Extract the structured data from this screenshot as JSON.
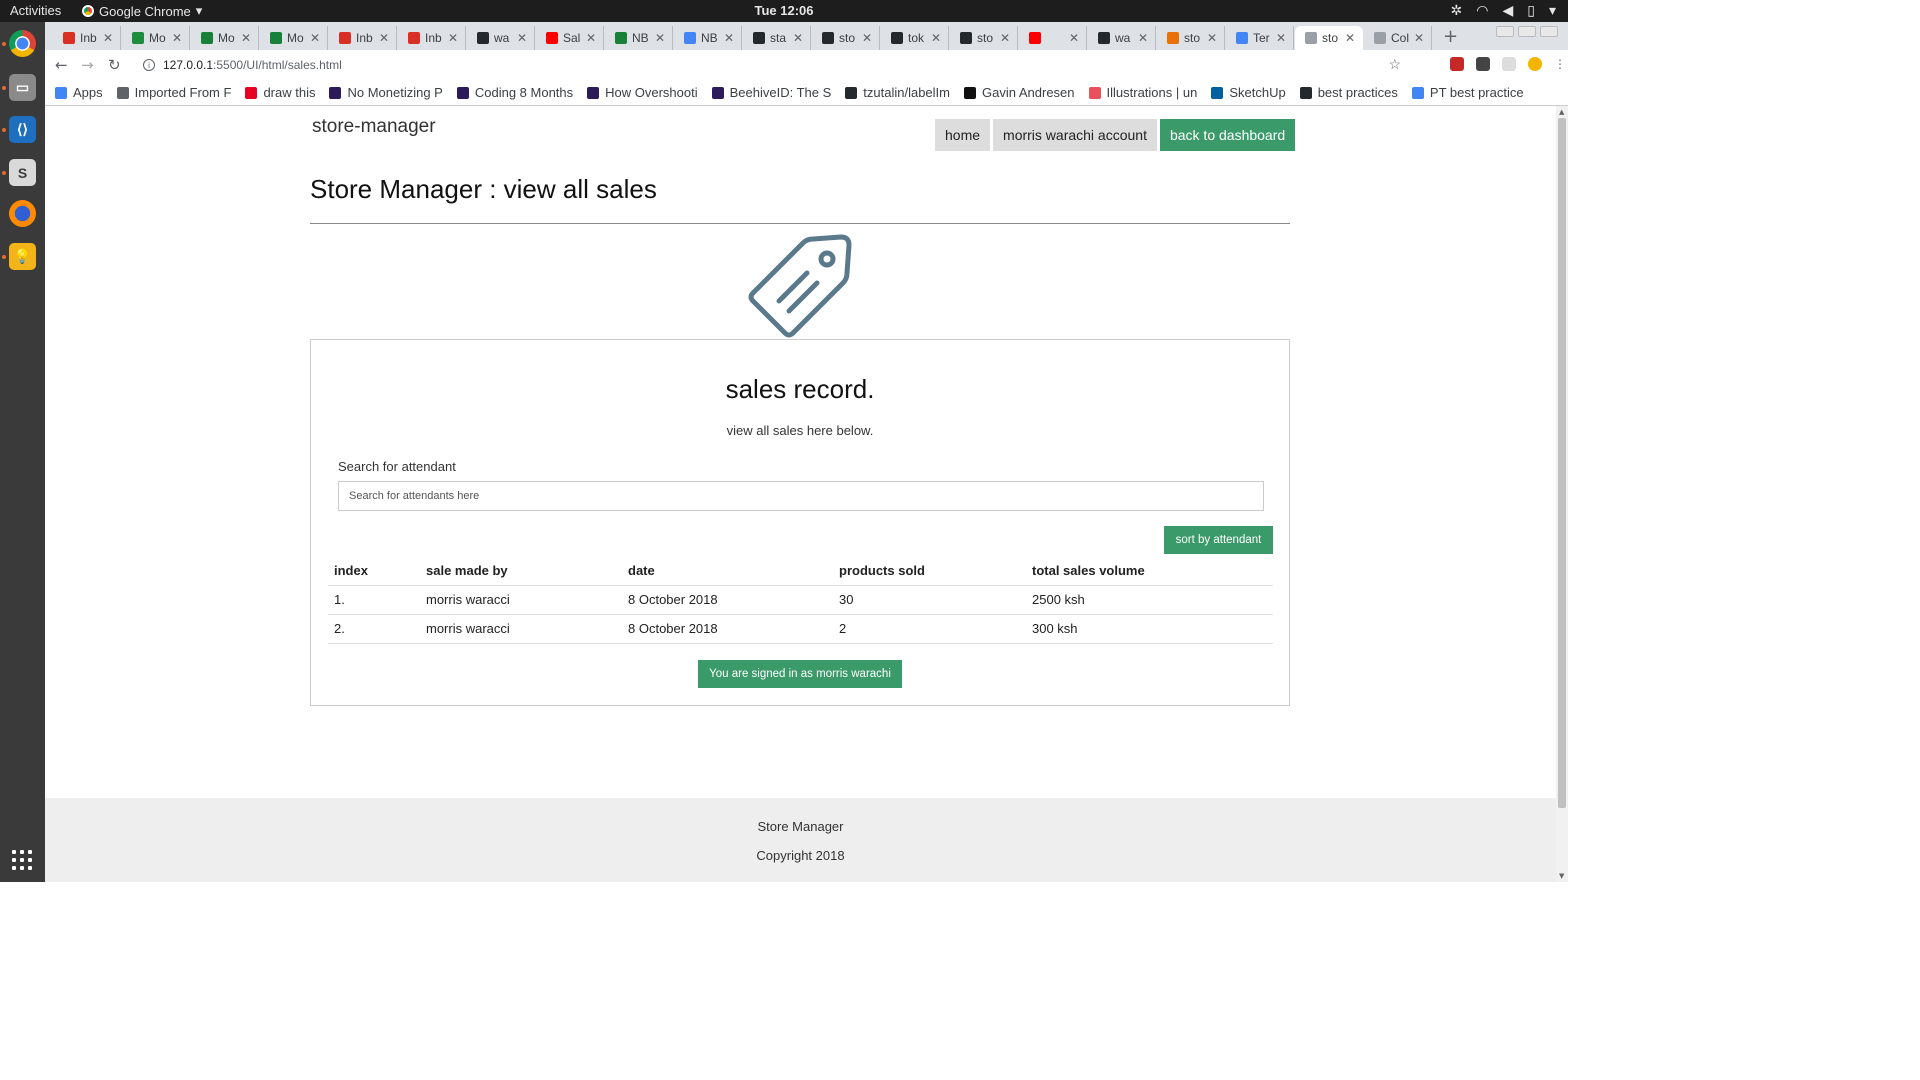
{
  "os": {
    "activities": "Activities",
    "app_name": "Google Chrome",
    "clock": "Tue 12:06"
  },
  "browser": {
    "tabs": [
      {
        "label": "Inb",
        "color": "#d93025"
      },
      {
        "label": "Mo",
        "color": "#1e8e3e"
      },
      {
        "label": "Mo",
        "color": "#188038"
      },
      {
        "label": "Mo",
        "color": "#188038"
      },
      {
        "label": "Inb",
        "color": "#d93025"
      },
      {
        "label": "Inb",
        "color": "#d93025"
      },
      {
        "label": "wa",
        "color": "#24292e"
      },
      {
        "label": "Sal",
        "color": "#ff0000"
      },
      {
        "label": "NB",
        "color": "#188038"
      },
      {
        "label": "NB",
        "color": "#4285f4"
      },
      {
        "label": "sta",
        "color": "#24292e"
      },
      {
        "label": "sto",
        "color": "#24292e"
      },
      {
        "label": "tok",
        "color": "#24292e"
      },
      {
        "label": "sto",
        "color": "#24292e"
      },
      {
        "label": "",
        "color": "#ff0000"
      },
      {
        "label": "wa",
        "color": "#24292e"
      },
      {
        "label": "sto",
        "color": "#e8710a"
      },
      {
        "label": "Ter",
        "color": "#4285f4"
      },
      {
        "label": "sto",
        "color": "#9aa0a6",
        "active": true
      },
      {
        "label": "Col",
        "color": "#9aa0a6"
      }
    ],
    "url_host": "127.0.0.1",
    "url_path": ":5500/UI/html/sales.html",
    "bookmarks": [
      {
        "label": "Apps",
        "color": "#4285f4"
      },
      {
        "label": "Imported From F",
        "color": "#5f6368"
      },
      {
        "label": "draw this",
        "color": "#e60023"
      },
      {
        "label": "No Monetizing P",
        "color": "#2b1b5a"
      },
      {
        "label": "Coding 8 Months",
        "color": "#2b1b5a"
      },
      {
        "label": "How Overshooti",
        "color": "#2b1b5a"
      },
      {
        "label": "BeehiveID: The S",
        "color": "#2b1b5a"
      },
      {
        "label": "tzutalin/labelIm",
        "color": "#24292e"
      },
      {
        "label": "Gavin Andresen",
        "color": "#111111"
      },
      {
        "label": "Illustrations | un",
        "color": "#e8505b"
      },
      {
        "label": "SketchUp",
        "color": "#005f9e"
      },
      {
        "label": "best practices",
        "color": "#24292e"
      },
      {
        "label": "PT best practice",
        "color": "#4285f4"
      }
    ]
  },
  "page": {
    "brand": "store-manager",
    "nav": {
      "home": "home",
      "account": "morris warachi account",
      "dashboard": "back to dashboard"
    },
    "title": "Store Manager : view all sales",
    "card": {
      "heading": "sales record.",
      "subheading": "view all sales here below.",
      "search_label": "Search for attendant",
      "search_placeholder": "Search for attendants here",
      "sort_button": "sort by attendant",
      "columns": [
        "index",
        "sale made by",
        "date",
        "products sold",
        "total sales volume"
      ],
      "rows": [
        [
          "1.",
          "morris waracci",
          "8 October 2018",
          "30",
          "2500 ksh"
        ],
        [
          "2.",
          "morris waracci",
          "8 October 2018",
          "2",
          "300 ksh"
        ]
      ],
      "signed_in": "You are signed in as morris warachi"
    },
    "footer": {
      "line1": "Store Manager",
      "line2": "Copyright 2018"
    }
  },
  "colors": {
    "accent_green": "#3a9a6a",
    "tag_icon": "#5a7a8c"
  }
}
